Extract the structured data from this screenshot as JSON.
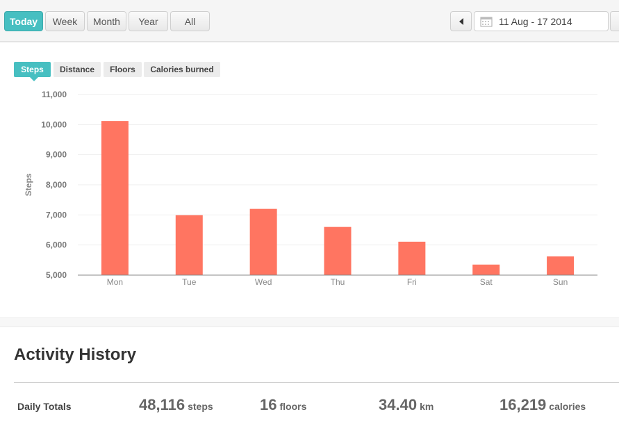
{
  "toolbar": {
    "ranges": [
      {
        "label": "Today",
        "active": true
      },
      {
        "label": "Week",
        "active": false
      },
      {
        "label": "Month",
        "active": false
      },
      {
        "label": "Year",
        "active": false
      },
      {
        "label": "All",
        "active": false
      }
    ],
    "prev_icon": "caret-left-icon",
    "calendar_icon": "calendar-icon",
    "date_range": "11 Aug - 17 2014"
  },
  "metric_tabs": [
    {
      "label": "Steps",
      "active": true
    },
    {
      "label": "Distance",
      "active": false
    },
    {
      "label": "Floors",
      "active": false
    },
    {
      "label": "Calories burned",
      "active": false
    }
  ],
  "colors": {
    "accent": "#47bfc1",
    "bar": "#ff7561",
    "grid": "#eeeeee"
  },
  "chart_data": {
    "type": "bar",
    "categories": [
      "Mon",
      "Tue",
      "Wed",
      "Thu",
      "Fri",
      "Sat",
      "Sun"
    ],
    "values": [
      10120,
      6990,
      7200,
      6600,
      6110,
      5350,
      5620
    ],
    "ylabel": "Steps",
    "xlabel": "",
    "ylim": [
      5000,
      11000
    ],
    "yticks": [
      "5,000",
      "6,000",
      "7,000",
      "8,000",
      "9,000",
      "10,000",
      "11,000"
    ],
    "grid": true
  },
  "history": {
    "title": "Activity History",
    "daily_totals_label": "Daily Totals",
    "totals": [
      {
        "value": "48,116",
        "unit": "steps"
      },
      {
        "value": "16",
        "unit": "floors"
      },
      {
        "value": "34.40",
        "unit": "km"
      },
      {
        "value": "16,219",
        "unit": "calories"
      }
    ]
  }
}
